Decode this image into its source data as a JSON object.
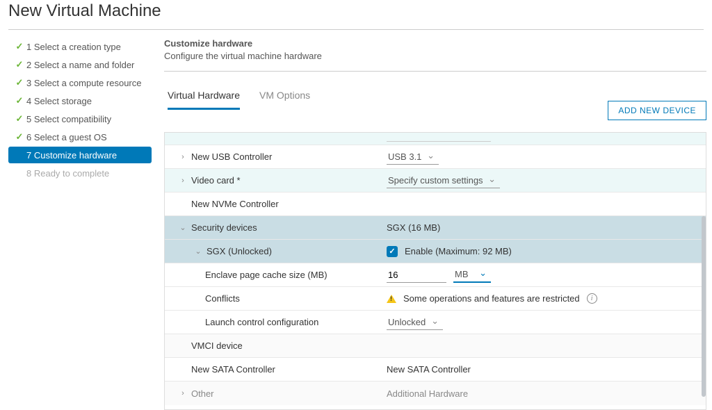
{
  "page": {
    "title": "New Virtual Machine"
  },
  "sidebar": {
    "steps": [
      {
        "label": "1 Select a creation type",
        "state": "done"
      },
      {
        "label": "2 Select a name and folder",
        "state": "done"
      },
      {
        "label": "3 Select a compute resource",
        "state": "done"
      },
      {
        "label": "4 Select storage",
        "state": "done"
      },
      {
        "label": "5 Select compatibility",
        "state": "done"
      },
      {
        "label": "6 Select a guest OS",
        "state": "done"
      },
      {
        "label": "7 Customize hardware",
        "state": "active"
      },
      {
        "label": "8 Ready to complete",
        "state": "pending"
      }
    ]
  },
  "main": {
    "heading": "Customize hardware",
    "subheading": "Configure the virtual machine hardware",
    "tabs": {
      "virtual_hardware": "Virtual Hardware",
      "vm_options": "VM Options"
    },
    "add_device": "ADD NEW DEVICE"
  },
  "hw": {
    "usb": {
      "label": "New USB Controller",
      "value": "USB 3.1"
    },
    "video": {
      "label": "Video card *",
      "value": "Specify custom settings"
    },
    "nvme": {
      "label": "New NVMe Controller"
    },
    "sec": {
      "label": "Security devices",
      "summary": "SGX (16 MB)",
      "sgx": {
        "label": "SGX (Unlocked)",
        "enable_label": "Enable (Maximum: 92 MB)",
        "epc_label": "Enclave page cache size (MB)",
        "epc_value": "16",
        "epc_unit": "MB",
        "conflicts_label": "Conflicts",
        "conflicts_msg": "Some operations and features are restricted",
        "launch_label": "Launch control configuration",
        "launch_value": "Unlocked"
      }
    },
    "vmci": {
      "label": "VMCI device"
    },
    "sata": {
      "label": "New SATA Controller",
      "value": "New SATA Controller"
    },
    "other": {
      "label": "Other",
      "value": "Additional Hardware"
    }
  }
}
